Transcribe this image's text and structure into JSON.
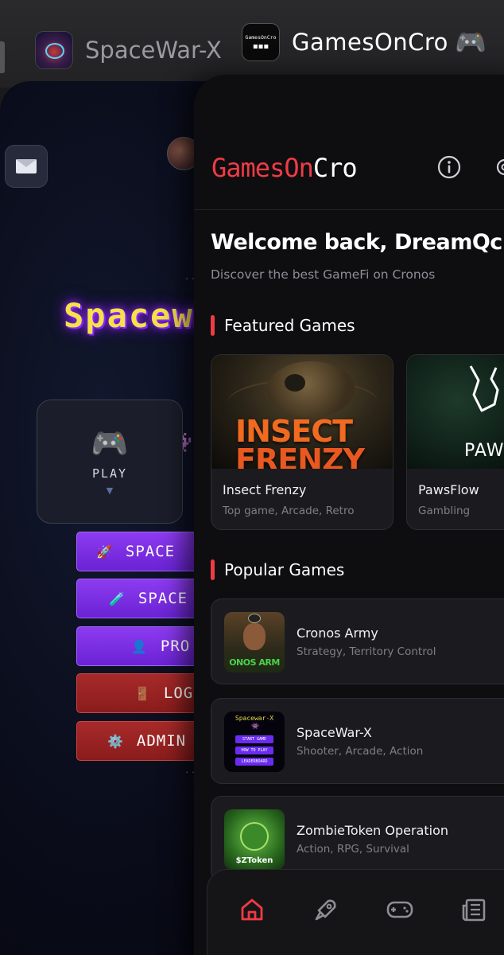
{
  "switcher": {
    "apps": [
      {
        "name": "SpaceWar-X",
        "icon": "spacewar-app-icon"
      },
      {
        "name": "GamesOnCro",
        "icon": "gamesoncro-app-icon",
        "icon_text": "GamesOnCro",
        "emoji": "🎮"
      }
    ]
  },
  "spacewar": {
    "title": "Spacewar",
    "play_label": "PLAY",
    "play_icon": "🎮",
    "alien_icon": "👾",
    "mail_icon": "mail-icon",
    "menu": [
      {
        "icon": "🚀",
        "label": "SPACE",
        "variant": "purple"
      },
      {
        "icon": "🧪",
        "label": "SPACE",
        "variant": "purple"
      },
      {
        "icon": "👤",
        "label": "PRO",
        "variant": "purple"
      },
      {
        "icon": "🚪",
        "label": "LOG",
        "variant": "red"
      },
      {
        "icon": "⚙️",
        "label": "ADMIN",
        "variant": "red"
      }
    ]
  },
  "gamesoncro": {
    "brand_red": "GamesOn",
    "brand_white": "Cro",
    "accent_color": "#ef3b45",
    "welcome": "Welcome back, DreamQc",
    "subtitle": "Discover the best GameFi on Cronos",
    "featured_title": "Featured Games",
    "featured": [
      {
        "name": "Insect Frenzy",
        "genres": "Top game, Arcade, Retro",
        "art_text_1": "INSECT",
        "art_text_2": "FRENZY"
      },
      {
        "name": "PawsFlow",
        "genres": "Gambling",
        "art_text": "PAWSF"
      }
    ],
    "popular_title": "Popular Games",
    "popular": [
      {
        "name": "Cronos Army",
        "genres": "Strategy, Territory Control",
        "thumb_text": "ONOS ARM"
      },
      {
        "name": "SpaceWar-X",
        "genres": "Shooter, Arcade, Action",
        "thumb_title": "Spacewar-X",
        "thumb_buttons": [
          "START GAME",
          "HOW TO PLAY",
          "LEADERBOARD"
        ]
      },
      {
        "name": "ZombieToken Operation",
        "genres": "Action, RPG, Survival",
        "thumb_text": "$ZToken"
      }
    ],
    "nav": [
      {
        "icon": "home-icon",
        "active": true
      },
      {
        "icon": "rocket-icon",
        "active": false
      },
      {
        "icon": "gamepad-icon",
        "active": false
      },
      {
        "icon": "news-icon",
        "active": false
      }
    ]
  }
}
